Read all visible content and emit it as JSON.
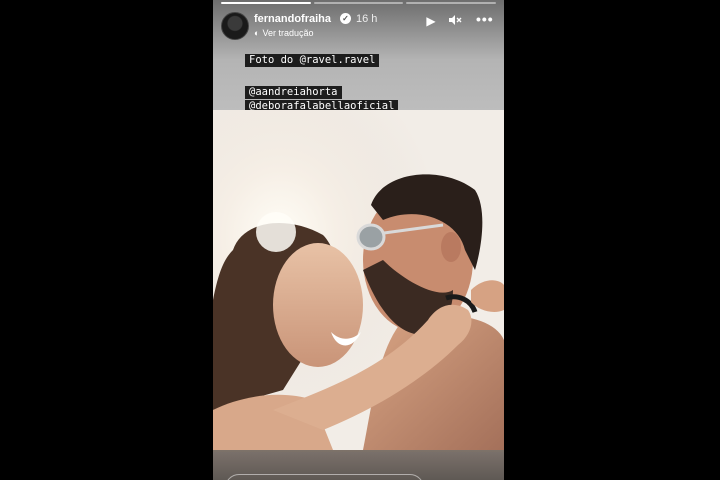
{
  "story": {
    "username": "fernandofraiha",
    "time": "16 h",
    "translate_label": "Ver tradução",
    "progress_segments": 3,
    "progress_current": 1
  },
  "captions": [
    "Foto do @ravel.ravel",
    "@aandreiahorta",
    "@deborafalabellaoficial"
  ],
  "icons": {
    "play": "play-icon",
    "mute": "mute-icon",
    "more": "more-icon",
    "verified": "verified-badge-icon"
  }
}
